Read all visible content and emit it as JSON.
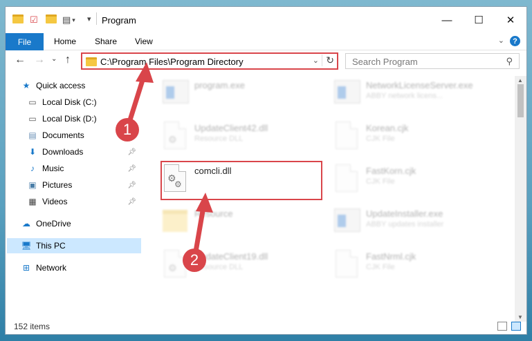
{
  "window": {
    "title": "Program"
  },
  "ribbon": {
    "file": "File",
    "home": "Home",
    "share": "Share",
    "view": "View",
    "help": "?"
  },
  "nav": {
    "back": "←",
    "forward": "→",
    "recent": "⌄",
    "up": "↑",
    "address_path": "C:\\Program Files\\Program Directory",
    "search_placeholder": "Search Program"
  },
  "sidebar": {
    "items": [
      {
        "label": "Quick access",
        "icon": "star-icon"
      },
      {
        "label": "Local Disk (C:)",
        "icon": "drive-icon"
      },
      {
        "label": "Local Disk (D:)",
        "icon": "drive-icon"
      },
      {
        "label": "Documents",
        "icon": "documents-icon"
      },
      {
        "label": "Downloads",
        "icon": "download-icon"
      },
      {
        "label": "Music",
        "icon": "music-icon"
      },
      {
        "label": "Pictures",
        "icon": "pictures-icon"
      },
      {
        "label": "Videos",
        "icon": "videos-icon"
      },
      {
        "label": "OneDrive",
        "icon": "cloud-icon"
      },
      {
        "label": "This PC",
        "icon": "computer-icon"
      },
      {
        "label": "Network",
        "icon": "network-icon"
      }
    ]
  },
  "files": {
    "col1": [
      {
        "name": "program.exe",
        "desc": ""
      },
      {
        "name": "UpdateClient42.dll",
        "desc": "Resource DLL"
      },
      {
        "name": "comcli.dll",
        "desc": ""
      },
      {
        "name": "Resource",
        "desc": ""
      },
      {
        "name": "UpdateClient19.dll",
        "desc": "Resource DLL"
      }
    ],
    "col2": [
      {
        "name": "NetworkLicenseServer.exe",
        "desc": "ABBY network licens..."
      },
      {
        "name": "Korean.cjk",
        "desc": "CJK File"
      },
      {
        "name": "FastKorn.cjk",
        "desc": "CJK File"
      },
      {
        "name": "UpdateInstaller.exe",
        "desc": "ABBY updates installer"
      },
      {
        "name": "FastNrml.cjk",
        "desc": "CJK File"
      }
    ]
  },
  "annotations": {
    "badge1": "1",
    "badge2": "2"
  },
  "status": {
    "count": "152 items"
  },
  "colors": {
    "accent": "#1979ca",
    "highlight": "#d9454a",
    "selected": "#cce8ff"
  }
}
